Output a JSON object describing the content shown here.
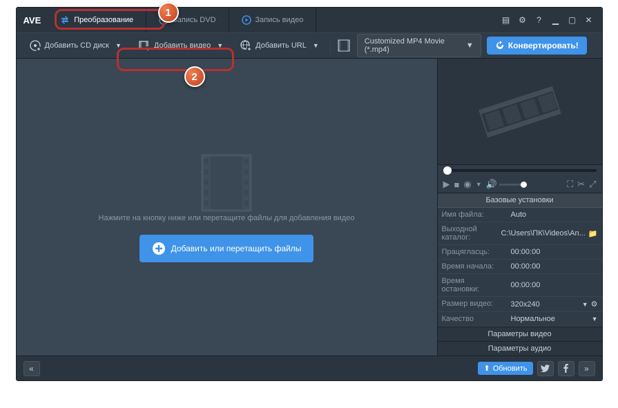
{
  "app_title": "AVE",
  "tabs": [
    {
      "label": "Преобразование",
      "active": true
    },
    {
      "label": "Запись DVD",
      "active": false
    },
    {
      "label": "Запись видео",
      "active": false
    }
  ],
  "toolbar": {
    "add_cd": "Добавить CD диск",
    "add_video": "Добавить видео",
    "add_url": "Добавить URL",
    "profile": "Customized MP4 Movie (*.mp4)",
    "convert": "Конвертировать!"
  },
  "main": {
    "hint": "Нажмите на кнопку ниже или перетащите файлы для добавления видео",
    "add": "Добавить или перетащить файлы"
  },
  "settings": {
    "header": "Базовые установки",
    "rows": [
      {
        "label": "Имя файла:",
        "value": "Auto"
      },
      {
        "label": "Выходной каталог:",
        "value": "C:\\Users\\ПК\\Videos\\An..."
      },
      {
        "label": "Працягласць:",
        "value": "00:00:00"
      },
      {
        "label": "Время начала:",
        "value": "00:00:00"
      },
      {
        "label": "Время остановки:",
        "value": "00:00:00"
      },
      {
        "label": "Размер видео:",
        "value": "320x240"
      },
      {
        "label": "Качество",
        "value": "Нормальное"
      }
    ],
    "video_params": "Параметры видео",
    "audio_params": "Параметры аудио"
  },
  "statusbar": {
    "upgrade": "Обновить"
  },
  "callouts": {
    "one": "1",
    "two": "2"
  }
}
